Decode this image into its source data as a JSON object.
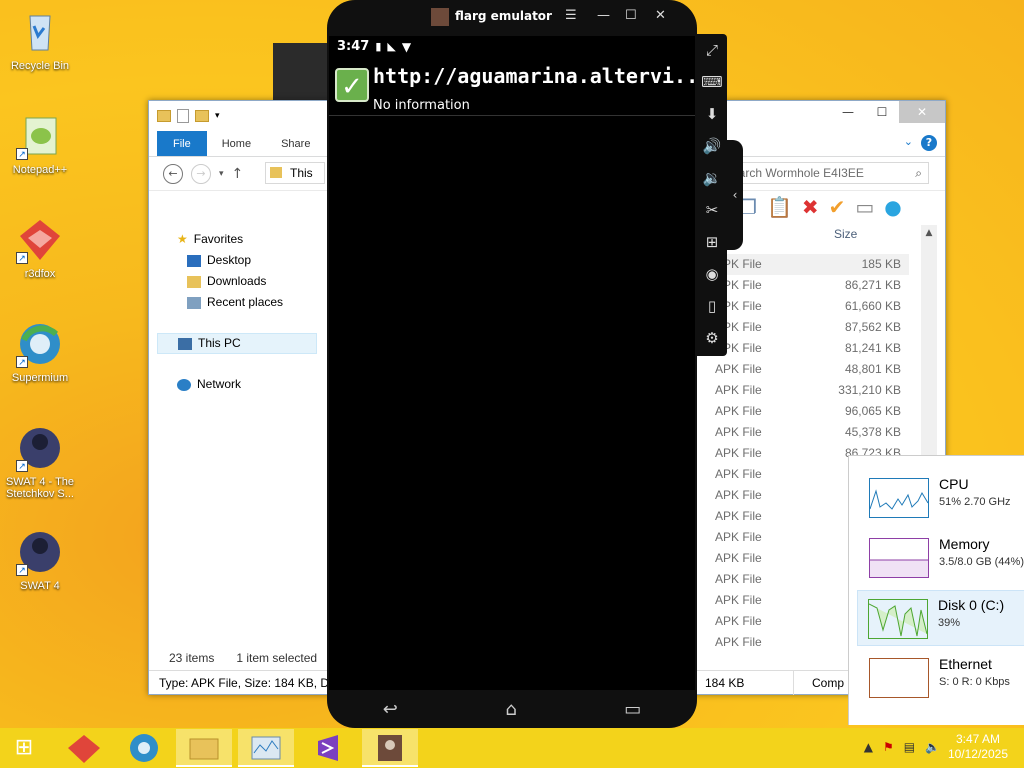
{
  "desktop": {
    "icons": [
      {
        "label": "Recycle Bin",
        "icon": "recycle-bin-icon"
      },
      {
        "label": "Notepad++",
        "icon": "notepad-plus-icon"
      },
      {
        "label": "r3dfox",
        "icon": "r3dfox-icon"
      },
      {
        "label": "Supermium",
        "icon": "supermium-icon"
      },
      {
        "label": "SWAT 4 - The Stetchkov S...",
        "icon": "swat4-stetchkov-icon"
      },
      {
        "label": "SWAT 4",
        "icon": "swat4-icon"
      }
    ]
  },
  "explorer": {
    "ribbon_tabs": [
      "File",
      "Home",
      "Share"
    ],
    "address": "This",
    "search_placeholder": "earch Wormhole E4I3EE",
    "nav": {
      "favorites": "Favorites",
      "desktop": "Desktop",
      "downloads": "Downloads",
      "recent": "Recent places",
      "this_pc": "This PC",
      "network": "Network"
    },
    "column_size": "Size",
    "files": [
      {
        "type": "APK File",
        "size": "185 KB"
      },
      {
        "type": "APK File",
        "size": "86,271 KB"
      },
      {
        "type": "APK File",
        "size": "61,660 KB"
      },
      {
        "type": "APK File",
        "size": "87,562 KB"
      },
      {
        "type": "APK File",
        "size": "81,241 KB"
      },
      {
        "type": "APK File",
        "size": "48,801 KB"
      },
      {
        "type": "APK File",
        "size": "331,210 KB"
      },
      {
        "type": "APK File",
        "size": "96,065 KB"
      },
      {
        "type": "APK File",
        "size": "45,378 KB"
      },
      {
        "type": "APK File",
        "size": "86,723 KB"
      },
      {
        "type": "APK File",
        "size": ""
      },
      {
        "type": "APK File",
        "size": ""
      },
      {
        "type": "APK File",
        "size": ""
      },
      {
        "type": "APK File",
        "size": ""
      },
      {
        "type": "APK File",
        "size": ""
      },
      {
        "type": "APK File",
        "size": ""
      },
      {
        "type": "APK File",
        "size": ""
      },
      {
        "type": "APK File",
        "size": ""
      },
      {
        "type": "APK File",
        "size": ""
      }
    ],
    "status_items": "23 items",
    "status_selected": "1 item selected",
    "status_extra": "1",
    "detail_text": "Type: APK File, Size: 184 KB, Date",
    "detail_size": "184 KB",
    "detail_comp": "Comp"
  },
  "taskmgr": {
    "cpu_name": "CPU",
    "cpu_val": "51% 2.70 GHz",
    "mem_name": "Memory",
    "mem_val": "3.5/8.0 GB (44%)",
    "disk_name": "Disk 0 (C:)",
    "disk_val": "39%",
    "eth_name": "Ethernet",
    "eth_val": "S: 0 R: 0 Kbps"
  },
  "emulator": {
    "title": "flarg emulator",
    "time": "3:47",
    "notif_url": "http://aguamarina.altervi...",
    "notif_sub": "No information"
  },
  "taskbar": {
    "time": "3:47 AM",
    "date": "10/12/2025"
  },
  "colors": {
    "accent": "#1979ca",
    "taskbar": "#f3d31b"
  }
}
